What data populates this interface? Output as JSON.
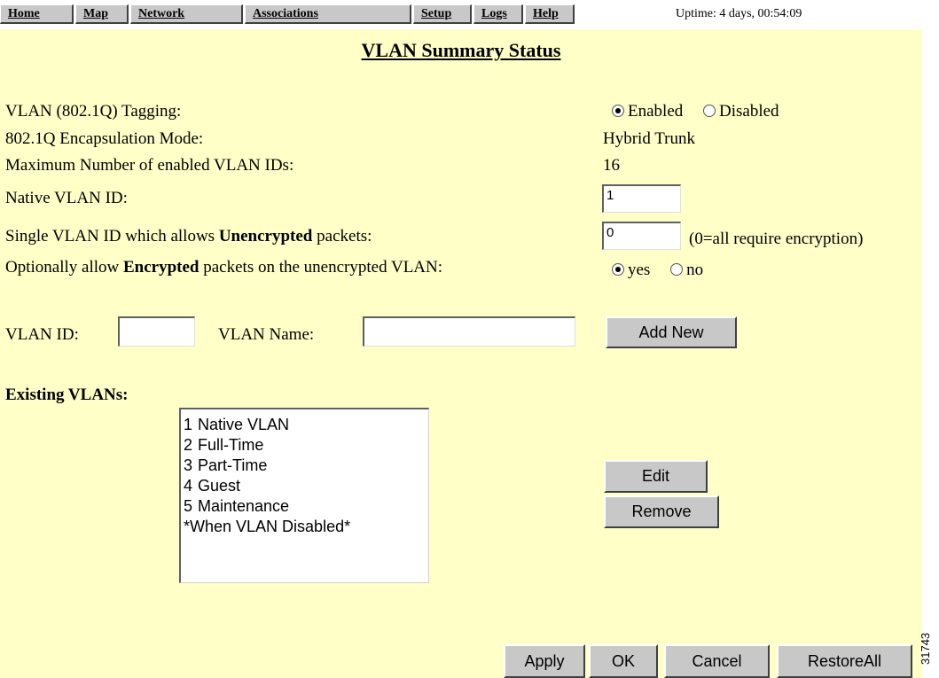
{
  "nav": {
    "items": [
      "Home",
      "Map",
      "Network",
      "Associations",
      "Setup",
      "Logs",
      "Help"
    ],
    "uptime": "Uptime: 4 days, 00:54:09"
  },
  "page_title": "VLAN Summary Status",
  "settings": {
    "tagging": {
      "label": "VLAN (802.1Q) Tagging:",
      "options": [
        "Enabled",
        "Disabled"
      ],
      "selected": "Enabled"
    },
    "encapsulation": {
      "label": "802.1Q Encapsulation Mode:",
      "value": "Hybrid Trunk"
    },
    "max_vlans": {
      "label": "Maximum Number of enabled VLAN IDs:",
      "value": "16"
    },
    "native_vlan": {
      "label": "Native VLAN ID:",
      "value": "1"
    },
    "unencrypted_vlan": {
      "label_pre": "Single VLAN ID which allows ",
      "label_bold": "Unencrypted",
      "label_post": " packets:",
      "value": "0",
      "hint": "(0=all require encryption)"
    },
    "allow_encrypted": {
      "label_pre": "Optionally allow ",
      "label_bold": "Encrypted",
      "label_post": " packets on the unencrypted VLAN:",
      "options": [
        "yes",
        "no"
      ],
      "selected": "yes"
    }
  },
  "add_form": {
    "vlan_id_label": "VLAN ID:",
    "vlan_id_value": "",
    "vlan_name_label": "VLAN Name:",
    "vlan_name_value": "",
    "add_button": "Add New"
  },
  "existing": {
    "heading": "Existing VLANs:",
    "items": [
      {
        "num": "1",
        "name": "Native VLAN"
      },
      {
        "num": "2",
        "name": "Full-Time"
      },
      {
        "num": "3",
        "name": "Part-Time"
      },
      {
        "num": "4",
        "name": "Guest"
      },
      {
        "num": "5",
        "name": "Maintenance"
      },
      {
        "num": "",
        "name": "*When VLAN Disabled*"
      }
    ],
    "edit_button": "Edit",
    "remove_button": "Remove"
  },
  "footer": {
    "apply": "Apply",
    "ok": "OK",
    "cancel": "Cancel",
    "restore_all": "RestoreAll"
  },
  "side_code": "31743"
}
